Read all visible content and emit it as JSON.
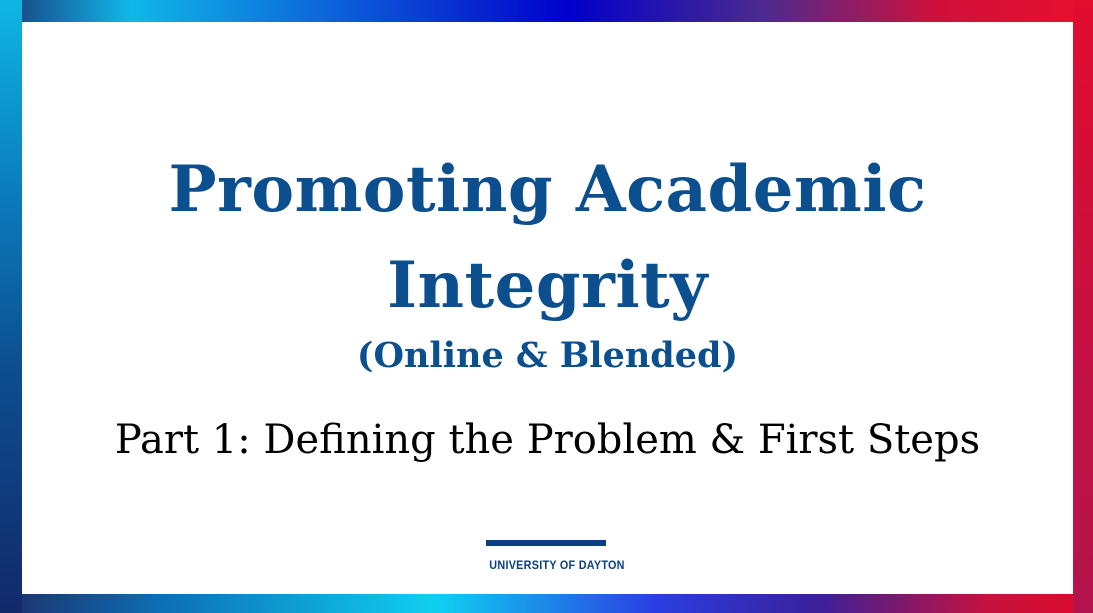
{
  "slide": {
    "title": "Promoting Academic Integrity",
    "subtitle": "(Online & Blended)",
    "part": "Part 1: Defining the Problem & First Steps"
  },
  "logo": {
    "text": "UNIVERSITY OF DAYTON"
  },
  "colors": {
    "title": "#0b4f8f",
    "logo": "#0b3f82",
    "frame_left": "#0fb6e2",
    "frame_right": "#e20d2f"
  }
}
